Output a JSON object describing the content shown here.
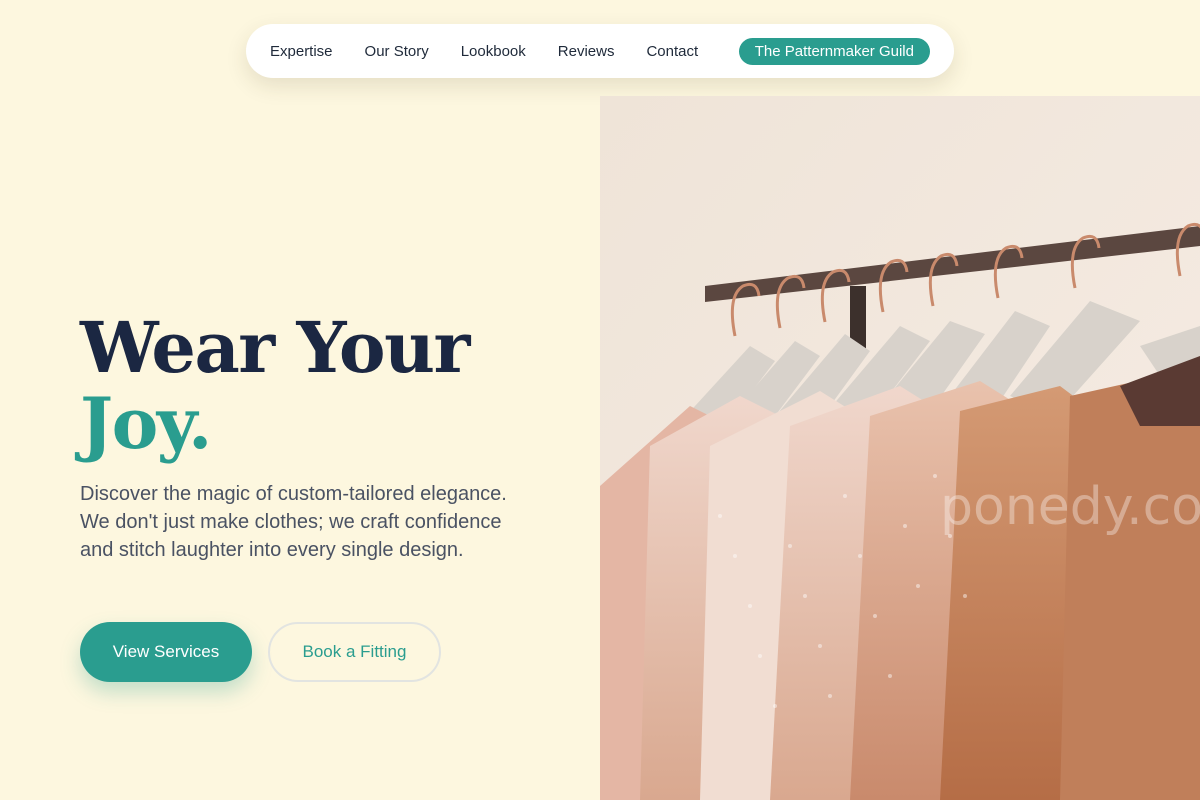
{
  "nav": {
    "links": [
      "Expertise",
      "Our Story",
      "Lookbook",
      "Reviews",
      "Contact"
    ],
    "cta": "The Patternmaker Guild"
  },
  "hero": {
    "title_line1": "Wear Your",
    "title_line2": "Joy.",
    "description": "Discover the magic of custom-tailored elegance. We don't just make clothes; we craft confidence and stitch laughter into every single design.",
    "primary_button": "View Services",
    "secondary_button": "Book a Fitting",
    "image_watermark": "ponedy.com"
  },
  "colors": {
    "background": "#fdf7df",
    "accent": "#2a9d8f",
    "heading": "#1b2742",
    "body_text": "#4a5263"
  },
  "icons": []
}
